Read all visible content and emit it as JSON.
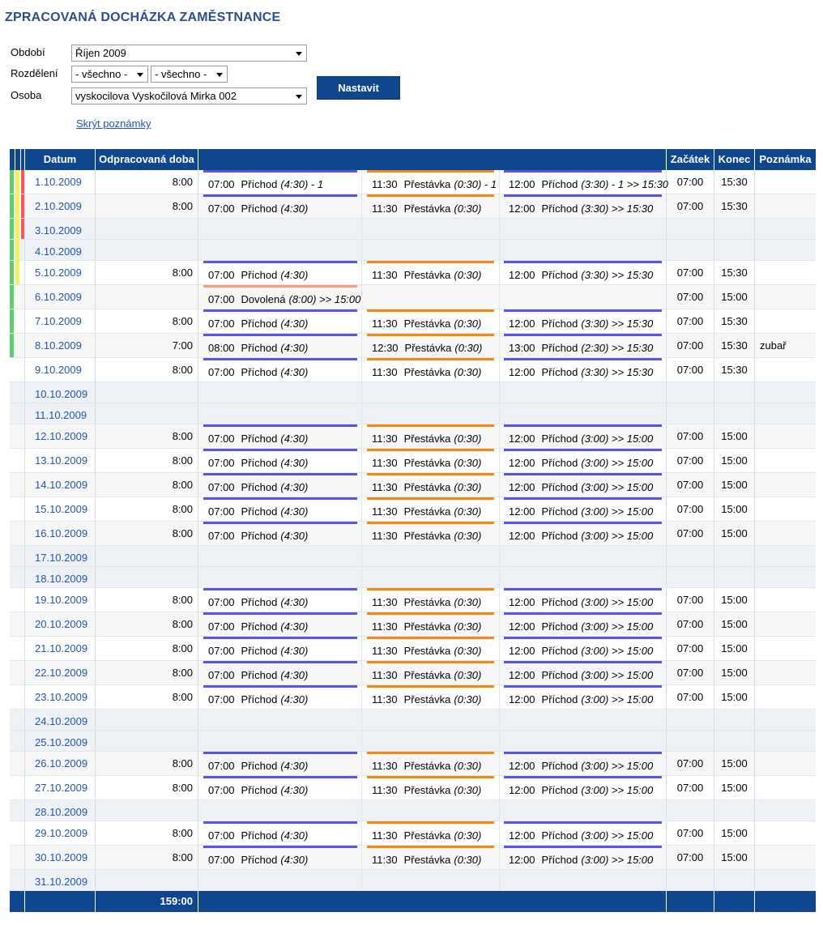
{
  "page_title": "ZPRACOVANÁ DOCHÁZKA ZAMĚSTNANCE",
  "filters": {
    "period_label": "Období",
    "period_value": "Říjen 2009",
    "division_label": "Rozdělení",
    "division_value_1": "- všechno -",
    "division_value_2": "- všechno -",
    "person_label": "Osoba",
    "person_value": "vyskocilova Vyskočilová Mirka 002",
    "submit_label": "Nastavit",
    "hide_notes_link": "Skrýt poznámky"
  },
  "colors": {
    "header_bg": "#0f468d",
    "arrival_bar": "#5a55e0",
    "break_bar": "#f08a12",
    "vacation_bar": "#f3a07c",
    "stripe_green": "#5bcf6b",
    "stripe_yellow": "#f4f15a",
    "stripe_red": "#ef5a5a",
    "link": "#1f57a6"
  },
  "table": {
    "columns": [
      "Datum",
      "Odpracovaná doba",
      "",
      "Začátek",
      "Konec",
      "Poznámka"
    ],
    "rows": [
      {
        "date": "1.10.2009",
        "worked": "8:00",
        "start": "07:00",
        "end": "15:30",
        "note": "",
        "stripes": [
          "green",
          "yellow",
          "red"
        ],
        "segments": [
          {
            "kind": "arrival",
            "time": "07:00",
            "label": "Příchod",
            "detail": "(4:30) - 1"
          },
          {
            "kind": "break",
            "time": "11:30",
            "label": "Přestávka",
            "detail": "(0:30) - 1"
          },
          {
            "kind": "arrival",
            "time": "12:00",
            "label": "Příchod",
            "detail": "(3:30) - 1 >> 15:30"
          }
        ]
      },
      {
        "date": "2.10.2009",
        "worked": "8:00",
        "start": "07:00",
        "end": "15:30",
        "note": "",
        "stripes": [
          "green",
          "yellow",
          "red"
        ],
        "segments": [
          {
            "kind": "arrival",
            "time": "07:00",
            "label": "Příchod",
            "detail": "(4:30)"
          },
          {
            "kind": "break",
            "time": "11:30",
            "label": "Přestávka",
            "detail": "(0:30)"
          },
          {
            "kind": "arrival",
            "time": "12:00",
            "label": "Příchod",
            "detail": "(3:30) >> 15:30"
          }
        ]
      },
      {
        "date": "3.10.2009",
        "worked": "",
        "start": "",
        "end": "",
        "note": "",
        "weekend": true,
        "stripes": [
          "green",
          "yellow",
          "red"
        ],
        "segments": []
      },
      {
        "date": "4.10.2009",
        "worked": "",
        "start": "",
        "end": "",
        "note": "",
        "weekend": true,
        "stripes": [
          "green",
          "yellow"
        ],
        "segments": []
      },
      {
        "date": "5.10.2009",
        "worked": "8:00",
        "start": "07:00",
        "end": "15:30",
        "note": "",
        "stripes": [
          "green",
          "yellow"
        ],
        "segments": [
          {
            "kind": "arrival",
            "time": "07:00",
            "label": "Příchod",
            "detail": "(4:30)"
          },
          {
            "kind": "break",
            "time": "11:30",
            "label": "Přestávka",
            "detail": "(0:30)"
          },
          {
            "kind": "arrival",
            "time": "12:00",
            "label": "Příchod",
            "detail": "(3:30) >> 15:30"
          }
        ]
      },
      {
        "date": "6.10.2009",
        "worked": "",
        "start": "07:00",
        "end": "15:00",
        "note": "",
        "stripes": [
          "green"
        ],
        "segments": [
          {
            "kind": "vacation",
            "time": "07:00",
            "label": "Dovolená",
            "detail": "(8:00) >> 15:00"
          }
        ]
      },
      {
        "date": "7.10.2009",
        "worked": "8:00",
        "start": "07:00",
        "end": "15:30",
        "note": "",
        "stripes": [
          "green"
        ],
        "segments": [
          {
            "kind": "arrival",
            "time": "07:00",
            "label": "Příchod",
            "detail": "(4:30)"
          },
          {
            "kind": "break",
            "time": "11:30",
            "label": "Přestávka",
            "detail": "(0:30)"
          },
          {
            "kind": "arrival",
            "time": "12:00",
            "label": "Příchod",
            "detail": "(3:30) >> 15:30"
          }
        ]
      },
      {
        "date": "8.10.2009",
        "worked": "7:00",
        "start": "07:00",
        "end": "15:30",
        "note": "zubař",
        "stripes": [
          "green"
        ],
        "segments": [
          {
            "kind": "arrival",
            "time": "08:00",
            "label": "Příchod",
            "detail": "(4:30)"
          },
          {
            "kind": "break",
            "time": "12:30",
            "label": "Přestávka",
            "detail": "(0:30)"
          },
          {
            "kind": "arrival",
            "time": "13:00",
            "label": "Příchod",
            "detail": "(2:30) >> 15:30"
          }
        ]
      },
      {
        "date": "9.10.2009",
        "worked": "8:00",
        "start": "07:00",
        "end": "15:30",
        "note": "",
        "stripes": [],
        "segments": [
          {
            "kind": "arrival",
            "time": "07:00",
            "label": "Příchod",
            "detail": "(4:30)"
          },
          {
            "kind": "break",
            "time": "11:30",
            "label": "Přestávka",
            "detail": "(0:30)"
          },
          {
            "kind": "arrival",
            "time": "12:00",
            "label": "Příchod",
            "detail": "(3:30) >> 15:30"
          }
        ]
      },
      {
        "date": "10.10.2009",
        "worked": "",
        "start": "",
        "end": "",
        "note": "",
        "weekend": true,
        "stripes": [],
        "segments": []
      },
      {
        "date": "11.10.2009",
        "worked": "",
        "start": "",
        "end": "",
        "note": "",
        "weekend": true,
        "stripes": [],
        "segments": []
      },
      {
        "date": "12.10.2009",
        "worked": "8:00",
        "start": "07:00",
        "end": "15:00",
        "note": "",
        "stripes": [],
        "segments": [
          {
            "kind": "arrival",
            "time": "07:00",
            "label": "Příchod",
            "detail": "(4:30)"
          },
          {
            "kind": "break",
            "time": "11:30",
            "label": "Přestávka",
            "detail": "(0:30)"
          },
          {
            "kind": "arrival",
            "time": "12:00",
            "label": "Příchod",
            "detail": "(3:00) >> 15:00"
          }
        ]
      },
      {
        "date": "13.10.2009",
        "worked": "8:00",
        "start": "07:00",
        "end": "15:00",
        "note": "",
        "stripes": [],
        "segments": [
          {
            "kind": "arrival",
            "time": "07:00",
            "label": "Příchod",
            "detail": "(4:30)"
          },
          {
            "kind": "break",
            "time": "11:30",
            "label": "Přestávka",
            "detail": "(0:30)"
          },
          {
            "kind": "arrival",
            "time": "12:00",
            "label": "Příchod",
            "detail": "(3:00) >> 15:00"
          }
        ]
      },
      {
        "date": "14.10.2009",
        "worked": "8:00",
        "start": "07:00",
        "end": "15:00",
        "note": "",
        "stripes": [],
        "segments": [
          {
            "kind": "arrival",
            "time": "07:00",
            "label": "Příchod",
            "detail": "(4:30)"
          },
          {
            "kind": "break",
            "time": "11:30",
            "label": "Přestávka",
            "detail": "(0:30)"
          },
          {
            "kind": "arrival",
            "time": "12:00",
            "label": "Příchod",
            "detail": "(3:00) >> 15:00"
          }
        ]
      },
      {
        "date": "15.10.2009",
        "worked": "8:00",
        "start": "07:00",
        "end": "15:00",
        "note": "",
        "stripes": [],
        "segments": [
          {
            "kind": "arrival",
            "time": "07:00",
            "label": "Příchod",
            "detail": "(4:30)"
          },
          {
            "kind": "break",
            "time": "11:30",
            "label": "Přestávka",
            "detail": "(0:30)"
          },
          {
            "kind": "arrival",
            "time": "12:00",
            "label": "Příchod",
            "detail": "(3:00) >> 15:00"
          }
        ]
      },
      {
        "date": "16.10.2009",
        "worked": "8:00",
        "start": "07:00",
        "end": "15:00",
        "note": "",
        "stripes": [],
        "segments": [
          {
            "kind": "arrival",
            "time": "07:00",
            "label": "Příchod",
            "detail": "(4:30)"
          },
          {
            "kind": "break",
            "time": "11:30",
            "label": "Přestávka",
            "detail": "(0:30)"
          },
          {
            "kind": "arrival",
            "time": "12:00",
            "label": "Příchod",
            "detail": "(3:00) >> 15:00"
          }
        ]
      },
      {
        "date": "17.10.2009",
        "worked": "",
        "start": "",
        "end": "",
        "note": "",
        "weekend": true,
        "stripes": [],
        "segments": []
      },
      {
        "date": "18.10.2009",
        "worked": "",
        "start": "",
        "end": "",
        "note": "",
        "weekend": true,
        "stripes": [],
        "segments": []
      },
      {
        "date": "19.10.2009",
        "worked": "8:00",
        "start": "07:00",
        "end": "15:00",
        "note": "",
        "stripes": [],
        "segments": [
          {
            "kind": "arrival",
            "time": "07:00",
            "label": "Příchod",
            "detail": "(4:30)"
          },
          {
            "kind": "break",
            "time": "11:30",
            "label": "Přestávka",
            "detail": "(0:30)"
          },
          {
            "kind": "arrival",
            "time": "12:00",
            "label": "Příchod",
            "detail": "(3:00) >> 15:00"
          }
        ]
      },
      {
        "date": "20.10.2009",
        "worked": "8:00",
        "start": "07:00",
        "end": "15:00",
        "note": "",
        "stripes": [],
        "segments": [
          {
            "kind": "arrival",
            "time": "07:00",
            "label": "Příchod",
            "detail": "(4:30)"
          },
          {
            "kind": "break",
            "time": "11:30",
            "label": "Přestávka",
            "detail": "(0:30)"
          },
          {
            "kind": "arrival",
            "time": "12:00",
            "label": "Příchod",
            "detail": "(3:00) >> 15:00"
          }
        ]
      },
      {
        "date": "21.10.2009",
        "worked": "8:00",
        "start": "07:00",
        "end": "15:00",
        "note": "",
        "stripes": [],
        "segments": [
          {
            "kind": "arrival",
            "time": "07:00",
            "label": "Příchod",
            "detail": "(4:30)"
          },
          {
            "kind": "break",
            "time": "11:30",
            "label": "Přestávka",
            "detail": "(0:30)"
          },
          {
            "kind": "arrival",
            "time": "12:00",
            "label": "Příchod",
            "detail": "(3:00) >> 15:00"
          }
        ]
      },
      {
        "date": "22.10.2009",
        "worked": "8:00",
        "start": "07:00",
        "end": "15:00",
        "note": "",
        "stripes": [],
        "segments": [
          {
            "kind": "arrival",
            "time": "07:00",
            "label": "Příchod",
            "detail": "(4:30)"
          },
          {
            "kind": "break",
            "time": "11:30",
            "label": "Přestávka",
            "detail": "(0:30)"
          },
          {
            "kind": "arrival",
            "time": "12:00",
            "label": "Příchod",
            "detail": "(3:00) >> 15:00"
          }
        ]
      },
      {
        "date": "23.10.2009",
        "worked": "8:00",
        "start": "07:00",
        "end": "15:00",
        "note": "",
        "stripes": [],
        "segments": [
          {
            "kind": "arrival",
            "time": "07:00",
            "label": "Příchod",
            "detail": "(4:30)"
          },
          {
            "kind": "break",
            "time": "11:30",
            "label": "Přestávka",
            "detail": "(0:30)"
          },
          {
            "kind": "arrival",
            "time": "12:00",
            "label": "Příchod",
            "detail": "(3:00) >> 15:00"
          }
        ]
      },
      {
        "date": "24.10.2009",
        "worked": "",
        "start": "",
        "end": "",
        "note": "",
        "weekend": true,
        "stripes": [],
        "segments": []
      },
      {
        "date": "25.10.2009",
        "worked": "",
        "start": "",
        "end": "",
        "note": "",
        "weekend": true,
        "stripes": [],
        "segments": []
      },
      {
        "date": "26.10.2009",
        "worked": "8:00",
        "start": "07:00",
        "end": "15:00",
        "note": "",
        "stripes": [],
        "segments": [
          {
            "kind": "arrival",
            "time": "07:00",
            "label": "Příchod",
            "detail": "(4:30)"
          },
          {
            "kind": "break",
            "time": "11:30",
            "label": "Přestávka",
            "detail": "(0:30)"
          },
          {
            "kind": "arrival",
            "time": "12:00",
            "label": "Příchod",
            "detail": "(3:00) >> 15:00"
          }
        ]
      },
      {
        "date": "27.10.2009",
        "worked": "8:00",
        "start": "07:00",
        "end": "15:00",
        "note": "",
        "stripes": [],
        "segments": [
          {
            "kind": "arrival",
            "time": "07:00",
            "label": "Příchod",
            "detail": "(4:30)"
          },
          {
            "kind": "break",
            "time": "11:30",
            "label": "Přestávka",
            "detail": "(0:30)"
          },
          {
            "kind": "arrival",
            "time": "12:00",
            "label": "Příchod",
            "detail": "(3:00) >> 15:00"
          }
        ]
      },
      {
        "date": "28.10.2009",
        "worked": "",
        "start": "",
        "end": "",
        "note": "",
        "weekend": true,
        "stripes": [],
        "segments": []
      },
      {
        "date": "29.10.2009",
        "worked": "8:00",
        "start": "07:00",
        "end": "15:00",
        "note": "",
        "stripes": [],
        "segments": [
          {
            "kind": "arrival",
            "time": "07:00",
            "label": "Příchod",
            "detail": "(4:30)"
          },
          {
            "kind": "break",
            "time": "11:30",
            "label": "Přestávka",
            "detail": "(0:30)"
          },
          {
            "kind": "arrival",
            "time": "12:00",
            "label": "Příchod",
            "detail": "(3:00) >> 15:00"
          }
        ]
      },
      {
        "date": "30.10.2009",
        "worked": "8:00",
        "start": "07:00",
        "end": "15:00",
        "note": "",
        "stripes": [],
        "segments": [
          {
            "kind": "arrival",
            "time": "07:00",
            "label": "Příchod",
            "detail": "(4:30)"
          },
          {
            "kind": "break",
            "time": "11:30",
            "label": "Přestávka",
            "detail": "(0:30)"
          },
          {
            "kind": "arrival",
            "time": "12:00",
            "label": "Příchod",
            "detail": "(3:00) >> 15:00"
          }
        ]
      },
      {
        "date": "31.10.2009",
        "worked": "",
        "start": "",
        "end": "",
        "note": "",
        "weekend": true,
        "stripes": [],
        "segments": []
      }
    ],
    "total_worked": "159:00"
  }
}
